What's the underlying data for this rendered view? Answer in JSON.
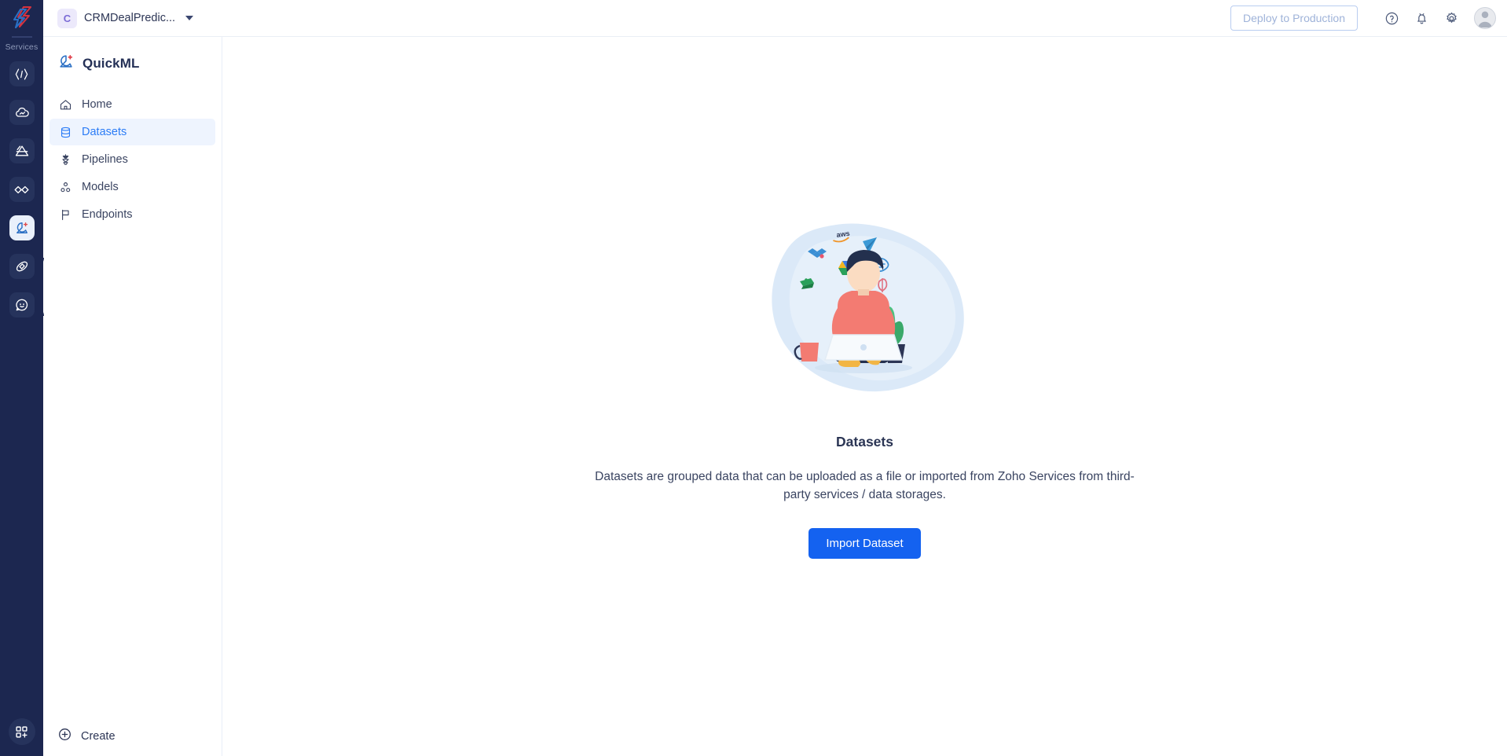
{
  "rail": {
    "logo_icon": "zoho-logo-icon",
    "section_label": "Services",
    "items": [
      {
        "icon": "code-service-icon",
        "active": false
      },
      {
        "icon": "cloud-service-icon",
        "active": false
      },
      {
        "icon": "flow-service-icon",
        "active": false
      },
      {
        "icon": "connect-service-icon",
        "active": false
      },
      {
        "icon": "quickml-service-icon",
        "active": true
      },
      {
        "icon": "orbit-service-icon",
        "active": false
      },
      {
        "icon": "chat-service-icon",
        "active": false
      }
    ],
    "apps_button_icon": "add-apps-grid-icon"
  },
  "topbar": {
    "project_initial": "C",
    "project_name": "CRMDealPredic...",
    "dropdown_icon": "chevron-down-icon",
    "deploy_label": "Deploy to Production",
    "help_icon": "help-circle-icon",
    "notifications_icon": "bell-icon",
    "settings_icon": "gear-icon",
    "avatar_icon": "user-avatar"
  },
  "sidebar": {
    "brand": "QuickML",
    "brand_icon": "quickml-logo-icon",
    "items": [
      {
        "label": "Home",
        "icon": "home-icon",
        "active": false
      },
      {
        "label": "Datasets",
        "icon": "database-icon",
        "active": true
      },
      {
        "label": "Pipelines",
        "icon": "pipeline-funnel-icon",
        "active": false
      },
      {
        "label": "Models",
        "icon": "models-nodes-icon",
        "active": false
      },
      {
        "label": "Endpoints",
        "icon": "flag-icon",
        "active": false
      }
    ],
    "create_label": "Create",
    "create_icon": "plus-circle-icon"
  },
  "main": {
    "illustration_icon": "person-with-laptop-illustration",
    "title": "Datasets",
    "description": "Datasets are grouped data that can be uploaded as a file or imported from Zoho Services from third-party services / data storages.",
    "import_label": "Import Dataset"
  },
  "colors": {
    "rail_bg": "#1c2750",
    "accent_blue": "#1462f0",
    "active_nav_bg": "#eef4fe",
    "active_nav_text": "#2b7cf6",
    "project_badge_bg": "#ece9fb",
    "project_badge_text": "#7b6bd6",
    "deploy_border": "#b9cdf0",
    "deploy_text": "#9fb3d9",
    "illustration_blob": "#dbe9f8"
  }
}
